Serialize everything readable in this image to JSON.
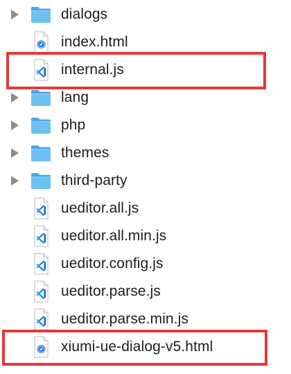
{
  "finder": {
    "items": [
      {
        "label": "dialogs",
        "kind": "folder",
        "icon": "folder-icon",
        "expandable": true
      },
      {
        "label": "index.html",
        "kind": "html",
        "icon": "html-file-icon",
        "expandable": false
      },
      {
        "label": "internal.js",
        "kind": "js",
        "icon": "vscode-js-file-icon",
        "expandable": false,
        "highlighted": true
      },
      {
        "label": "lang",
        "kind": "folder",
        "icon": "folder-icon",
        "expandable": true
      },
      {
        "label": "php",
        "kind": "folder",
        "icon": "folder-icon",
        "expandable": true
      },
      {
        "label": "themes",
        "kind": "folder",
        "icon": "folder-icon",
        "expandable": true
      },
      {
        "label": "third-party",
        "kind": "folder",
        "icon": "folder-icon",
        "expandable": true
      },
      {
        "label": "ueditor.all.js",
        "kind": "js",
        "icon": "vscode-js-file-icon",
        "expandable": false
      },
      {
        "label": "ueditor.all.min.js",
        "kind": "js",
        "icon": "vscode-js-file-icon",
        "expandable": false
      },
      {
        "label": "ueditor.config.js",
        "kind": "js",
        "icon": "vscode-js-file-icon",
        "expandable": false
      },
      {
        "label": "ueditor.parse.js",
        "kind": "js",
        "icon": "vscode-js-file-icon",
        "expandable": false
      },
      {
        "label": "ueditor.parse.min.js",
        "kind": "js",
        "icon": "vscode-js-file-icon",
        "expandable": false
      },
      {
        "label": "xiumi-ue-dialog-v5.html",
        "kind": "html",
        "icon": "html-file-icon",
        "expandable": false,
        "highlighted": true
      }
    ]
  },
  "colors": {
    "highlight": "#e53935",
    "folder": "#5db4ea",
    "vscode_blue": "#1e88e5",
    "safari_blue": "#2f7fd8",
    "disclosure": "#8c8c8c"
  }
}
